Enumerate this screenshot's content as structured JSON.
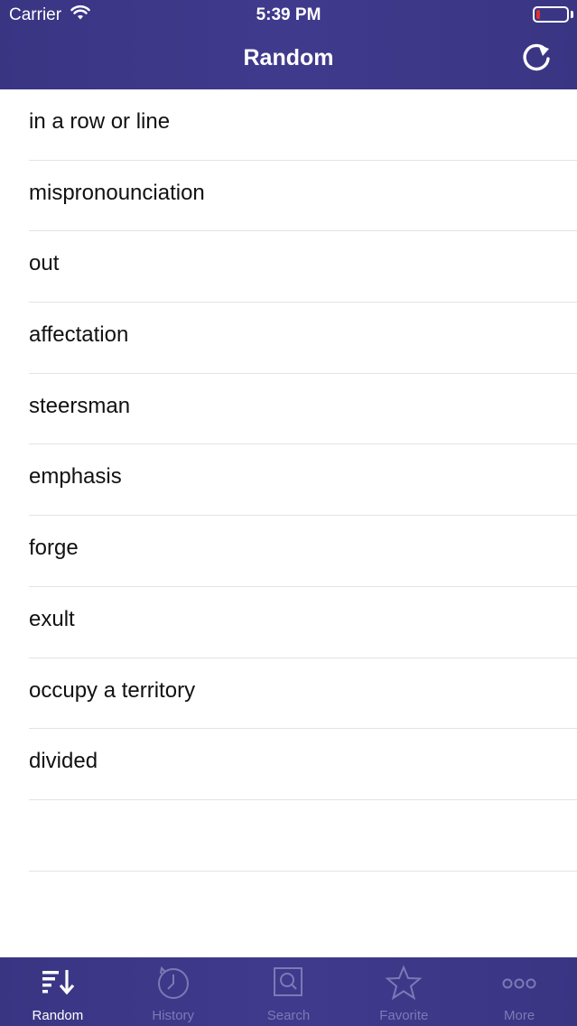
{
  "status_bar": {
    "carrier": "Carrier",
    "time": "5:39 PM",
    "battery_color": "#e0302b"
  },
  "nav": {
    "title": "Random",
    "refresh_icon": "refresh-icon"
  },
  "words": [
    "in a row or line",
    "mispronounciation",
    "out",
    "affectation",
    "steersman",
    "emphasis",
    "forge",
    "exult",
    "occupy a territory",
    "divided",
    ""
  ],
  "tabs": [
    {
      "label": "Random",
      "icon": "random-sort-icon",
      "active": true
    },
    {
      "label": "History",
      "icon": "history-clock-icon",
      "active": false
    },
    {
      "label": "Search",
      "icon": "search-icon",
      "active": false
    },
    {
      "label": "Favorite",
      "icon": "star-icon",
      "active": false
    },
    {
      "label": "More",
      "icon": "more-dots-icon",
      "active": false
    }
  ],
  "colors": {
    "bar": "#3d378a",
    "active": "#ffffff",
    "inactive": "#7e79b5"
  }
}
